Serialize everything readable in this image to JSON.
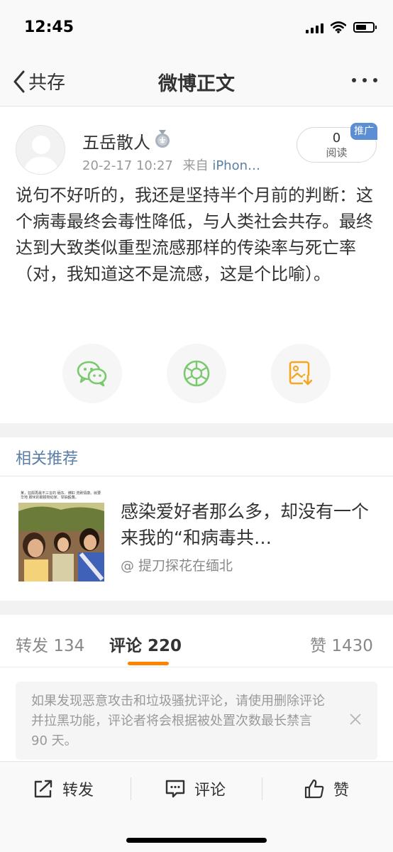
{
  "status_bar": {
    "time": "12:45"
  },
  "nav": {
    "back_label": "共存",
    "title": "微博正文"
  },
  "post": {
    "author": "五岳散人",
    "timestamp": "20-2-17 10:27",
    "source_prefix": "来自",
    "source": "iPhon…",
    "read_count": "0",
    "read_label": "阅读",
    "promo_badge": "推广",
    "text": "说句不好听的，我还是坚持半个月前的判断：这个病毒最终会毒性降低，与人类社会共存。最终达到大致类似重型流感那样的传染率与死亡率（对，我知道这不是流感，这是个比喻）。"
  },
  "share": [
    "wechat-icon",
    "moments-icon",
    "save-image-icon"
  ],
  "related": {
    "section_title": "相关推荐",
    "headline": "感染爱好者那么多，却没有一个来我的“和病毒共…",
    "source": "@ 提刀探花在缅北",
    "thumb_caption": "某，狂酹再最不三言的 缅东、佛缸 洗刷情康。就要华地 脚米的期报物动家、举抽殴蔑。"
  },
  "tabs": [
    {
      "label": "转发",
      "count": "134"
    },
    {
      "label": "评论",
      "count": "220"
    },
    {
      "label": "赞",
      "count": "1430"
    }
  ],
  "notice": {
    "text": "如果发现恶意攻击和垃圾骚扰评论，请使用删除评论并拉黑功能，评论者将会根据被处置次数最长禁言 90 天。"
  },
  "bottom_bar": {
    "repost": "转发",
    "comment": "评论",
    "like": "赞"
  },
  "colors": {
    "accent": "#ff8200",
    "link": "#5b7ea6",
    "badge": "#5c8ed3",
    "wechat": "#7bc96f",
    "save": "#f5a623"
  }
}
